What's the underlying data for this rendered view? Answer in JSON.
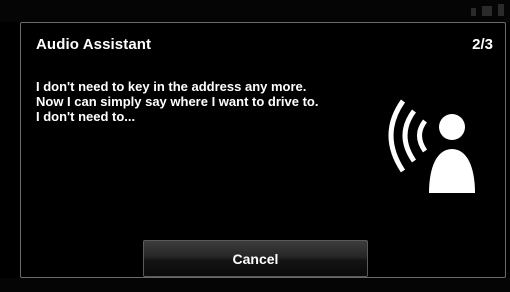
{
  "dialog": {
    "title": "Audio Assistant",
    "page_indicator": "2/3",
    "message_lines": [
      "I don't need to key in the address any more.",
      "Now I can simply say where I want to drive to.",
      "I don't need to..."
    ],
    "voice_icon": "speaking-person-icon",
    "cancel_label": "Cancel"
  },
  "colors": {
    "background": "#000000",
    "text": "#ffffff",
    "border": "#6b6b6b"
  }
}
